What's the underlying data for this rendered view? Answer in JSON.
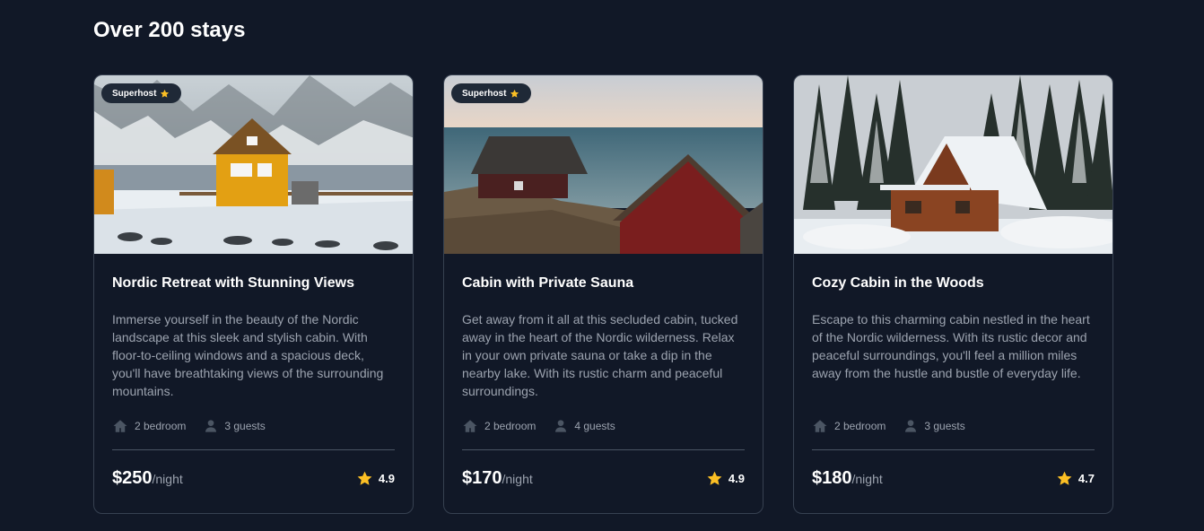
{
  "heading": "Over 200 stays",
  "badge": {
    "label": "Superhost"
  },
  "colors": {
    "background": "#111827",
    "star": "#fbbf24",
    "muted": "#9ca3af",
    "border": "#374151"
  },
  "cards": [
    {
      "title": "Nordic Retreat with Stunning Views",
      "description": "Immerse yourself in the beauty of the Nordic landscape at this sleek and stylish cabin. With floor-to-ceiling windows and a spacious deck, you'll have breathtaking views of the surrounding mountains.",
      "superhost": true,
      "bedrooms": "2 bedroom",
      "guests": "3 guests",
      "price": "$250",
      "per": "/night",
      "rating": "4.9",
      "image_icon": "yellow-house-snow-mountain-photo"
    },
    {
      "title": "Cabin with Private Sauna",
      "description": "Get away from it all at this secluded cabin, tucked away in the heart of the Nordic wilderness. Relax in your own private sauna or take a dip in the nearby lake. With its rustic charm and peaceful surroundings.",
      "superhost": true,
      "bedrooms": "2 bedroom",
      "guests": "4 guests",
      "price": "$170",
      "per": "/night",
      "rating": "4.9",
      "image_icon": "red-cabins-by-sea-photo"
    },
    {
      "title": "Cozy Cabin in the Woods",
      "description": "Escape to this charming cabin nestled in the heart of the Nordic wilderness. With its rustic decor and peaceful surroundings, you'll feel a million miles away from the hustle and bustle of everyday life.",
      "superhost": false,
      "bedrooms": "2 bedroom",
      "guests": "3 guests",
      "price": "$180",
      "per": "/night",
      "rating": "4.7",
      "image_icon": "cabin-in-snowy-forest-photo"
    }
  ]
}
